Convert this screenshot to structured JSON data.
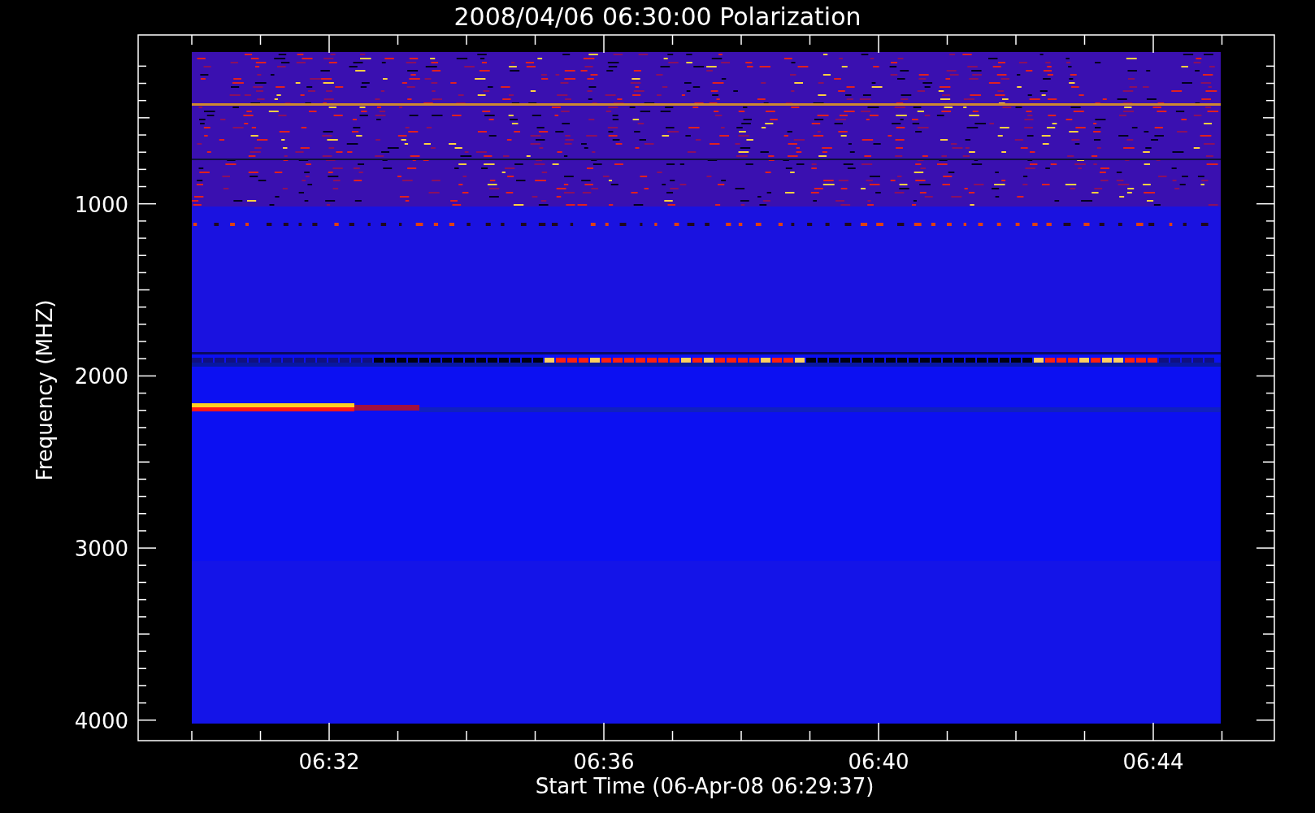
{
  "title": "2008/04/06 06:30:00 Polarization",
  "y_axis": {
    "label": "Frequency (MHZ)",
    "ticks": [
      "1000",
      "2000",
      "3000",
      "4000"
    ]
  },
  "x_axis": {
    "label": "Start Time (06-Apr-08 06:29:37)",
    "ticks": [
      "06:32",
      "06:36",
      "06:40",
      "06:44"
    ]
  }
}
